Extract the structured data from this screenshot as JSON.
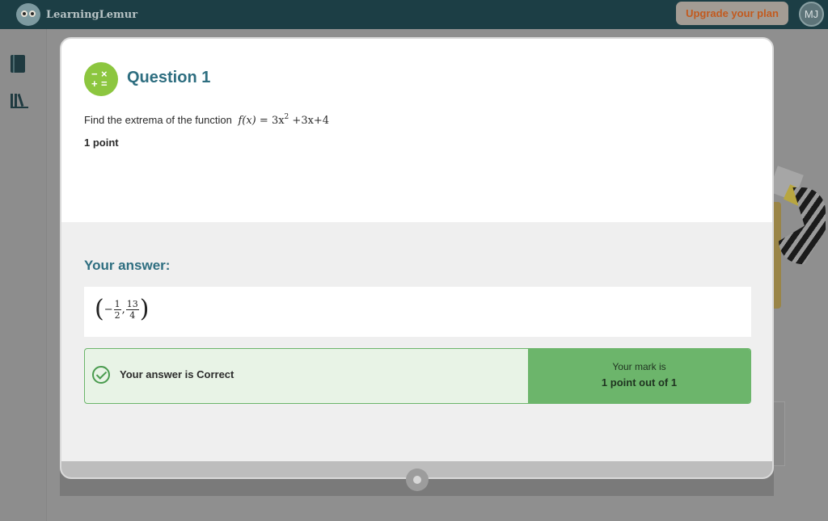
{
  "header": {
    "brand_name": "LearningLemur",
    "logo_icon": "lemur-logo-icon",
    "upgrade_label": "Upgrade your plan",
    "avatar_initials": "MJ"
  },
  "sidebar": {
    "items": [
      {
        "icon": "book-icon"
      },
      {
        "icon": "library-icon"
      }
    ]
  },
  "modal": {
    "icon": "calculator-operations-icon",
    "title": "Question 1",
    "question_text": "Find the extrema of the function",
    "function": {
      "lhs": "f(x)",
      "eq": "=",
      "term1": "3x",
      "exponent": "2",
      "rest": "+3x+4"
    },
    "points": "1 point",
    "answer_heading": "Your answer:",
    "answer": {
      "minus": "−",
      "frac1": {
        "num": "1",
        "den": "2"
      },
      "comma": ",",
      "frac2": {
        "num": "13",
        "den": "4"
      }
    },
    "result_text": "Your answer is Correct",
    "mark_label": "Your mark is",
    "mark_value": "1 point out of 1"
  },
  "colors": {
    "brand": "#1c3e45",
    "accent_teal": "#2e6e80",
    "success_green": "#6cb56b",
    "success_light": "#e8f3e6",
    "icon_green": "#8cc63f",
    "upgrade_text": "#c25a1e"
  }
}
